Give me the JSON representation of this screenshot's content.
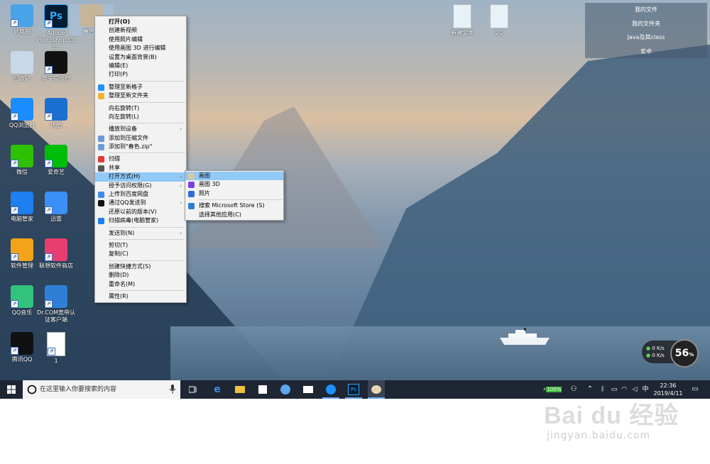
{
  "desktop": {
    "icons": [
      {
        "label": "此电脑",
        "icon": "computer-icon"
      },
      {
        "label": "Adobe Photoshop CC 2...",
        "icon": "photoshop-icon"
      },
      {
        "label": "春色...",
        "icon": "image-file-icon"
      },
      {
        "label": "回收站",
        "icon": "recycle-bin-icon"
      },
      {
        "label": "命令提示符",
        "icon": "cmd-icon"
      },
      {
        "label": "QQ浏览器",
        "icon": "qq-browser-icon"
      },
      {
        "label": "优酷",
        "icon": "youku-icon"
      },
      {
        "label": "微信",
        "icon": "wechat-icon"
      },
      {
        "label": "爱奇艺",
        "icon": "iqiyi-icon"
      },
      {
        "label": "电脑管家",
        "icon": "pc-manager-icon"
      },
      {
        "label": "迅雷",
        "icon": "thunder-icon"
      },
      {
        "label": "软件管理",
        "icon": "software-manager-icon"
      },
      {
        "label": "联想软件商店",
        "icon": "lenovo-store-icon"
      },
      {
        "label": "QQ音乐",
        "icon": "qq-music-icon"
      },
      {
        "label": "Dr.COM宽带认证客户端",
        "icon": "drcom-icon"
      },
      {
        "label": "腾讯QQ",
        "icon": "qq-icon"
      },
      {
        "label": "1",
        "icon": "document-icon"
      },
      {
        "label": "新建文本",
        "icon": "text-file-icon"
      },
      {
        "label": "20",
        "icon": "text-file-icon"
      }
    ],
    "top_right_panel": [
      "我的文件",
      "我的文件夹",
      "Java及其class",
      "安卓"
    ]
  },
  "context_menu": {
    "items": [
      {
        "label": "打开(O)",
        "bold": true
      },
      {
        "label": "创建新视频"
      },
      {
        "label": "使用照片编辑"
      },
      {
        "label": "使用画图 3D 进行编辑"
      },
      {
        "label": "设置为桌面背景(B)"
      },
      {
        "label": "编辑(E)"
      },
      {
        "label": "打印(P)"
      },
      {
        "sep": true
      },
      {
        "label": "整理至新格子",
        "icon": "fences-icon"
      },
      {
        "label": "整理至新文件夹",
        "icon": "folder-icon"
      },
      {
        "sep": true
      },
      {
        "label": "向右旋转(T)"
      },
      {
        "label": "向左旋转(L)"
      },
      {
        "sep": true
      },
      {
        "label": "播放到设备",
        "submenu": true
      },
      {
        "label": "添加到压缩文件",
        "icon": "archive-icon"
      },
      {
        "label": "添加到\"春色.zip\"",
        "icon": "archive-icon"
      },
      {
        "sep": true
      },
      {
        "label": "扫描",
        "icon": "scan-icon"
      },
      {
        "label": "共享",
        "icon": "share-icon"
      },
      {
        "label": "打开方式(H)",
        "submenu": true,
        "highlight": true
      },
      {
        "label": "授予访问权限(G)",
        "submenu": true
      },
      {
        "label": "上传到百度网盘",
        "icon": "cloud-icon"
      },
      {
        "label": "通过QQ发送到",
        "submenu": true,
        "icon": "qq-icon"
      },
      {
        "label": "还原以前的版本(V)"
      },
      {
        "label": "扫描病毒(电脑管家)",
        "icon": "shield-icon"
      },
      {
        "sep": true
      },
      {
        "label": "发送到(N)",
        "submenu": true
      },
      {
        "sep": true
      },
      {
        "label": "剪切(T)"
      },
      {
        "label": "复制(C)"
      },
      {
        "sep": true
      },
      {
        "label": "创建快捷方式(S)"
      },
      {
        "label": "删除(D)"
      },
      {
        "label": "重命名(M)"
      },
      {
        "sep": true
      },
      {
        "label": "属性(R)"
      }
    ]
  },
  "submenu": {
    "items": [
      {
        "label": "画图",
        "icon": "paint-icon",
        "highlight": true
      },
      {
        "label": "画图 3D",
        "icon": "paint3d-icon"
      },
      {
        "label": "照片",
        "icon": "photos-icon"
      },
      {
        "sep": true
      },
      {
        "label": "搜索 Microsoft Store (S)",
        "icon": "store-icon"
      },
      {
        "label": "选择其他应用(C)"
      }
    ]
  },
  "taskbar": {
    "search_placeholder": "在这里输入你要搜索的内容",
    "battery": "100%",
    "ime": "中",
    "time": "22:36",
    "date": "2019/4/11"
  },
  "gauge": {
    "value": "56",
    "unit": "%",
    "up": "0 K/s",
    "down": "0 K/s"
  },
  "watermark": {
    "brand": "Bai du 经验",
    "url": "jingyan.baidu.com"
  }
}
